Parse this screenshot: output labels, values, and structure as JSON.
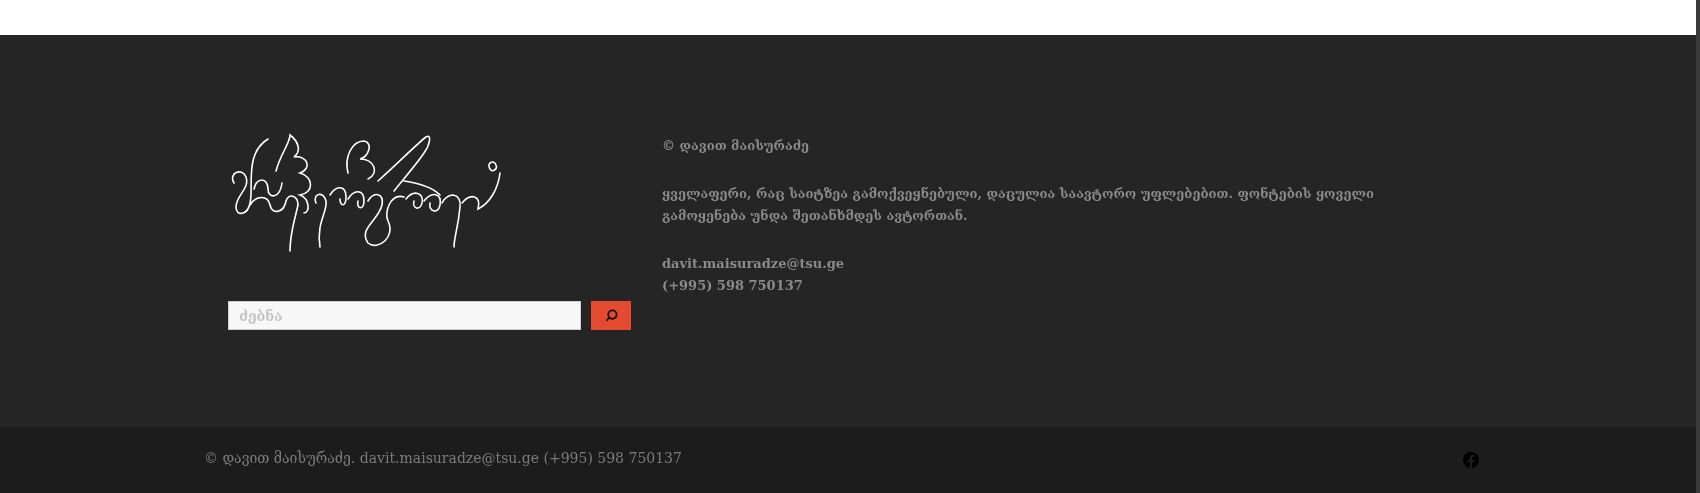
{
  "search": {
    "placeholder": "ძებნა"
  },
  "info": {
    "copyright": "© დავით მაისურაძე",
    "notice": "ყველაფერი, რაც საიტზეა გამოქვეყნებული, დაცულია საავტორო უფლებებით. ფონტების ყოველი გამოყენება უნდა შეთანხმდეს ავტორთან.",
    "email": "davit.maisuradze@tsu.ge",
    "phone": "(+995) 598 750137"
  },
  "bottom_bar": {
    "text": "© დავით მაისურაძე. davit.maisuradze@tsu.ge (+995) 598 750137",
    "social": [
      {
        "kind": "facebook"
      }
    ]
  }
}
